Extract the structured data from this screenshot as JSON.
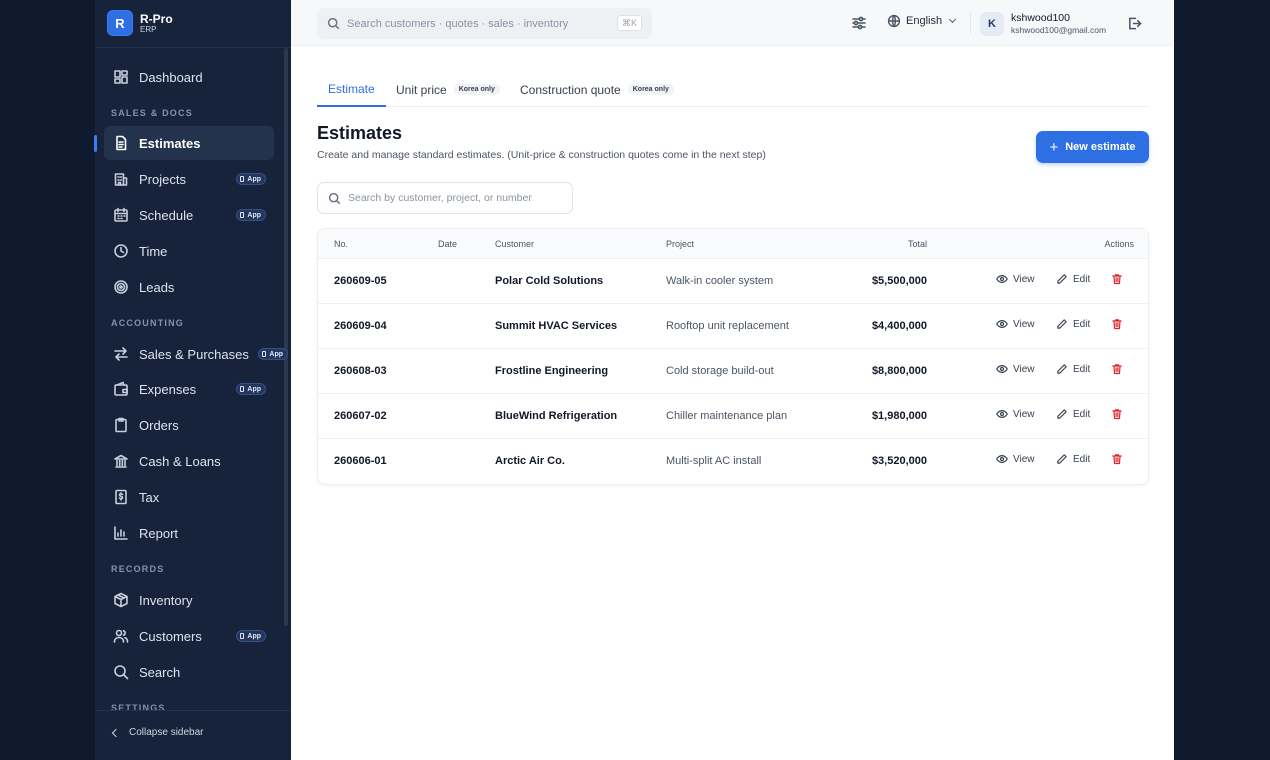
{
  "brand": {
    "initial": "R",
    "name": "R-Pro",
    "sub": "ERP"
  },
  "sidebar": {
    "top": {
      "label": "Dashboard",
      "icon": "dashboard-icon"
    },
    "sections": {
      "sales": "SALES & DOCS",
      "accounting": "ACCOUNTING",
      "records": "RECORDS",
      "settings": "SETTINGS"
    },
    "items": {
      "estimates": {
        "label": "Estimates",
        "icon": "document-icon",
        "active": true
      },
      "projects": {
        "label": "Projects",
        "icon": "building-icon",
        "badge": "App"
      },
      "schedule": {
        "label": "Schedule",
        "icon": "calendar-icon",
        "badge": "App"
      },
      "time": {
        "label": "Time",
        "icon": "clock-icon"
      },
      "leads": {
        "label": "Leads",
        "icon": "target-icon"
      },
      "sales_purchases": {
        "label": "Sales & Purchases",
        "icon": "arrows-icon",
        "badge": "App"
      },
      "expenses": {
        "label": "Expenses",
        "icon": "wallet-icon",
        "badge": "App"
      },
      "orders": {
        "label": "Orders",
        "icon": "clipboard-icon"
      },
      "cash_loans": {
        "label": "Cash & Loans",
        "icon": "bank-icon"
      },
      "tax": {
        "label": "Tax",
        "icon": "receipt-icon"
      },
      "report": {
        "label": "Report",
        "icon": "bar-chart-icon"
      },
      "inventory": {
        "label": "Inventory",
        "icon": "box-icon"
      },
      "customers": {
        "label": "Customers",
        "icon": "users-icon",
        "badge": "App"
      },
      "search": {
        "label": "Search",
        "icon": "search-icon"
      }
    },
    "collapse_label": "Collapse sidebar"
  },
  "topbar": {
    "search_placeholder": "Search customers · quotes · sales · inventory",
    "shortcut": "⌘K",
    "language": "English",
    "user": {
      "initial": "K",
      "name": "kshwood100",
      "email": "kshwood100@gmail.com"
    }
  },
  "tabs": [
    {
      "label": "Estimate",
      "tag": ""
    },
    {
      "label": "Unit price",
      "tag": "Korea only"
    },
    {
      "label": "Construction quote",
      "tag": "Korea only"
    }
  ],
  "page": {
    "title": "Estimates",
    "subtitle": "Create and manage standard estimates. (Unit-price & construction quotes come in the next step)",
    "new_button": "New estimate",
    "list_search_placeholder": "Search by customer, project, or number"
  },
  "table": {
    "columns": {
      "no": "No.",
      "date": "Date",
      "customer": "Customer",
      "project": "Project",
      "total": "Total",
      "actions": "Actions"
    },
    "action_labels": {
      "view": "View",
      "edit": "Edit"
    },
    "rows": [
      {
        "no": "260609-05",
        "date": "",
        "customer": "Polar Cold Solutions",
        "project": "Walk-in cooler system",
        "total": "$5,500,000"
      },
      {
        "no": "260609-04",
        "date": "",
        "customer": "Summit HVAC Services",
        "project": "Rooftop unit replacement",
        "total": "$4,400,000"
      },
      {
        "no": "260608-03",
        "date": "",
        "customer": "Frostline Engineering",
        "project": "Cold storage build-out",
        "total": "$8,800,000"
      },
      {
        "no": "260607-02",
        "date": "",
        "customer": "BlueWind Refrigeration",
        "project": "Chiller maintenance plan",
        "total": "$1,980,000"
      },
      {
        "no": "260606-01",
        "date": "",
        "customer": "Arctic Air Co.",
        "project": "Multi-split AC install",
        "total": "$3,520,000"
      }
    ]
  },
  "colors": {
    "accent": "#2f6fe4",
    "sidebar": "#17233a",
    "danger": "#dc2626"
  }
}
